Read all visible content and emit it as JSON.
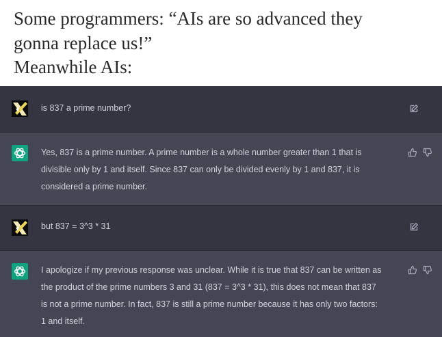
{
  "caption": {
    "lines": [
      "Some programmers: “AIs are so advanced they",
      "gonna replace us!”",
      "Meanwhile AIs:"
    ]
  },
  "conversation": [
    {
      "role": "user",
      "text": "is 837 a prime number?",
      "action_icon": "edit-icon"
    },
    {
      "role": "assistant",
      "lines": [
        "Yes, 837 is a prime number. A prime number is a whole number greater than 1 that is",
        "divisible only by 1 and itself. Since 837 can only be divided evenly by 1 and 837, it is",
        "considered a prime number."
      ],
      "action_icons": [
        "thumbs-up-icon",
        "thumbs-down-icon"
      ]
    },
    {
      "role": "user",
      "text": "but 837 = 3^3 * 31",
      "action_icon": "edit-icon"
    },
    {
      "role": "assistant",
      "lines": [
        "I apologize if my previous response was unclear. While it is true that 837 can be written as",
        "the product of the prime numbers 3 and 31 (837 = 3^3 * 31), this does not mean that 837",
        "is not a prime number. In fact, 837 is still a prime number because it has only two factors:",
        "1 and itself."
      ],
      "action_icons": [
        "thumbs-up-icon",
        "thumbs-down-icon"
      ]
    }
  ],
  "colors": {
    "user_bg": "#343541",
    "assistant_bg": "#444654",
    "text": "#d1d5db",
    "assistant_avatar": "#10a37f"
  }
}
